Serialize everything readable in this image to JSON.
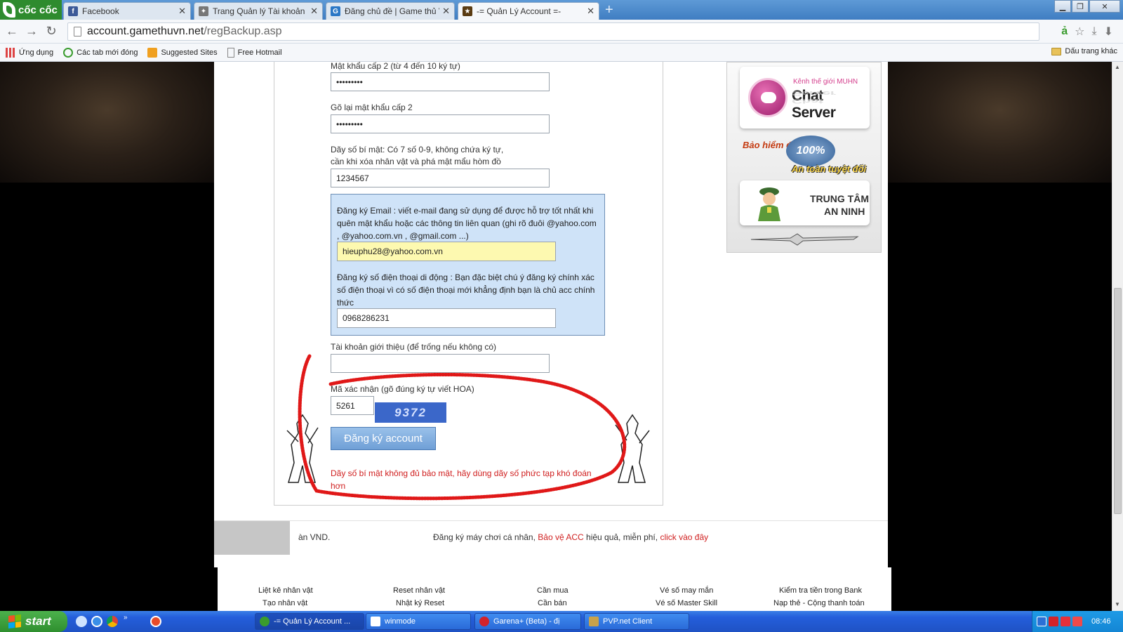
{
  "browser": {
    "logo": "cốc cốc",
    "tabs": [
      {
        "title": "Facebook",
        "icon": "facebook-icon"
      },
      {
        "title": "Trang Quản lý Tài khoản - M",
        "icon": "game-icon"
      },
      {
        "title": "Đăng chủ đề | Game thủ Việt",
        "icon": "g-icon"
      },
      {
        "title": "-= Quản Lý Account =-",
        "icon": "account-icon"
      }
    ],
    "url_domain": "account.gamethuvn.net",
    "url_path": "/regBackup.asp",
    "bookmarks": [
      "Ứng dụng",
      "Các tab mới đóng",
      "Suggested Sites",
      "Free Hotmail"
    ],
    "other_bookmarks": "Dấu trang khác"
  },
  "form": {
    "pw2_label": "Mật khẩu cấp 2 (từ 4 đến 10 ký tự)",
    "pw2_value": "•••••••••",
    "pw2_confirm_label": "Gõ lại mật khẩu cấp 2",
    "pw2_confirm_value": "•••••••••",
    "secret_label_1": "Dãy số bí mật: Có 7 số 0-9, không chứa ký tự,",
    "secret_label_2": "cần khi xóa nhân vật và phá mật mẩu hòm đồ",
    "secret_value": "1234567",
    "email_text": "Đăng ký Email : viết e-mail đang sử dụng để được hỗ trợ tốt nhất khi quên mật khẩu hoặc các thông tin liên quan (ghi rõ đuôi @yahoo.com , @yahoo.com.vn , @gmail.com ...)",
    "email_value": "hieuphu28@yahoo.com.vn",
    "phone_text": "Đăng ký số điện thoại di động : Bạn đặc biệt chú ý đăng ký chính xác số điện thoại vì có số điện thoại mới khẳng định bạn là chủ acc chính thức",
    "phone_value": "0968286231",
    "referral_label": "Tài khoản giới thiệu (để trống nếu không có)",
    "referral_value": "",
    "captcha_label": "Mã xác nhận (gõ đúng ký tự viết HOA)",
    "captcha_value": "5261",
    "captcha_image_text": "9372",
    "submit_label": "Đăng ký account",
    "warning": "Dãy số bí mật không đủ bảo mật, hãy dùng dãy số phức tạp khó đoán hơn"
  },
  "sidebar": {
    "chat_small": "Kênh thế giới MUHN",
    "chat_big": "Chat Server",
    "insure_line1": "Bảo hiểm đồ",
    "insure_badge": "100%",
    "insure_line2": "An toàn tuyệt đối",
    "security_line1": "TRUNG TÂM",
    "security_line2": "AN NINH"
  },
  "regbar": {
    "left_text": "àn VND.",
    "msg_prefix": "Đăng ký máy chơi cá nhân,",
    "msg_link1": "Bảo vệ ACC",
    "msg_middle": "hiệu quả, miễn phí,",
    "msg_link2": "click vào đây"
  },
  "footer": {
    "links": [
      "Liệt kê nhân vật",
      "Reset nhân vật",
      "Cần mua",
      "Vé số may mắn",
      "Kiểm tra tiền trong Bank"
    ],
    "links_row2": [
      "Tạo nhân vật",
      "Nhật ký Reset",
      "Cần bán",
      "Vé số Master Skill",
      "Nạp thẻ - Cộng thanh toán"
    ]
  },
  "taskbar": {
    "start": "start",
    "tasks": [
      "-= Quản Lý Account ...",
      "winmode",
      "Garena+ (Beta) - đị",
      "PVP.net Client"
    ],
    "clock": "08:46"
  },
  "colors": {
    "accent": "#3b67c9",
    "warning": "#d02020",
    "email_highlight": "#fdf9b0",
    "blue_panel": "#cfe3f8"
  }
}
